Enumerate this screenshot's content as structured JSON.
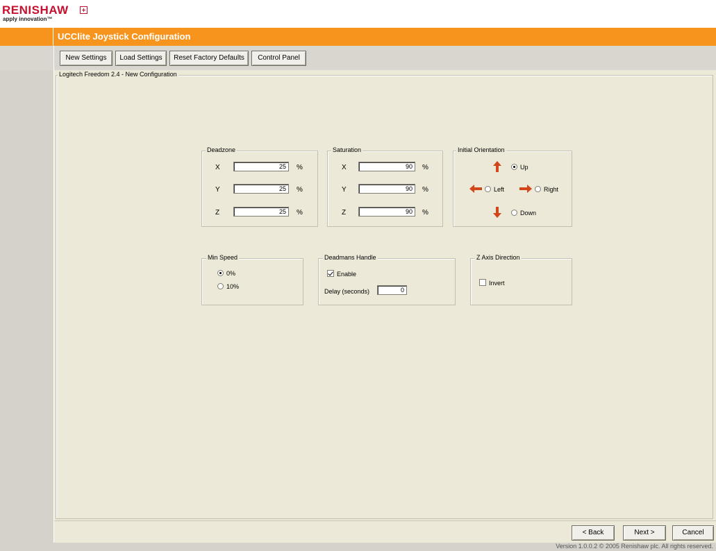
{
  "logo": {
    "word": "RENISHAW",
    "tagline": "apply innovation™"
  },
  "window": {
    "title": "UCClite Joystick Configuration"
  },
  "toolbar": {
    "new_settings": "New Settings",
    "load_settings": "Load Settings",
    "reset_defaults": "Reset Factory Defaults",
    "control_panel": "Control Panel"
  },
  "config_group": {
    "label": "Logitech Freedom 2.4 - New Configuration"
  },
  "deadzone": {
    "label": "Deadzone",
    "rows": [
      {
        "axis": "X",
        "value": "25",
        "unit": "%"
      },
      {
        "axis": "Y",
        "value": "25",
        "unit": "%"
      },
      {
        "axis": "Z",
        "value": "25",
        "unit": "%"
      }
    ]
  },
  "saturation": {
    "label": "Saturation",
    "rows": [
      {
        "axis": "X",
        "value": "90",
        "unit": "%"
      },
      {
        "axis": "Y",
        "value": "90",
        "unit": "%"
      },
      {
        "axis": "Z",
        "value": "90",
        "unit": "%"
      }
    ]
  },
  "orientation": {
    "label": "Initial Orientation",
    "up": "Up",
    "left": "Left",
    "right": "Right",
    "down": "Down",
    "selected": "Up"
  },
  "min_speed": {
    "label": "Min Speed",
    "option_0": "0%",
    "option_10": "10%",
    "selected": "0%"
  },
  "deadmans": {
    "label": "Deadmans Handle",
    "enable": "Enable",
    "enabled": true,
    "delay_label": "Delay (seconds)",
    "delay_value": "0"
  },
  "z_axis": {
    "label": "Z Axis Direction",
    "invert": "Invert",
    "inverted": false
  },
  "wizard": {
    "back": "< Back",
    "next": "Next >",
    "cancel": "Cancel"
  },
  "footer": {
    "version": "Version 1.0.0.2 © 2005 Renishaw plc. All rights reserved."
  },
  "colors": {
    "accent": "#f7941d",
    "brand_red": "#c8102e",
    "panel": "#ece9d8",
    "arrow": "#d1471b"
  }
}
